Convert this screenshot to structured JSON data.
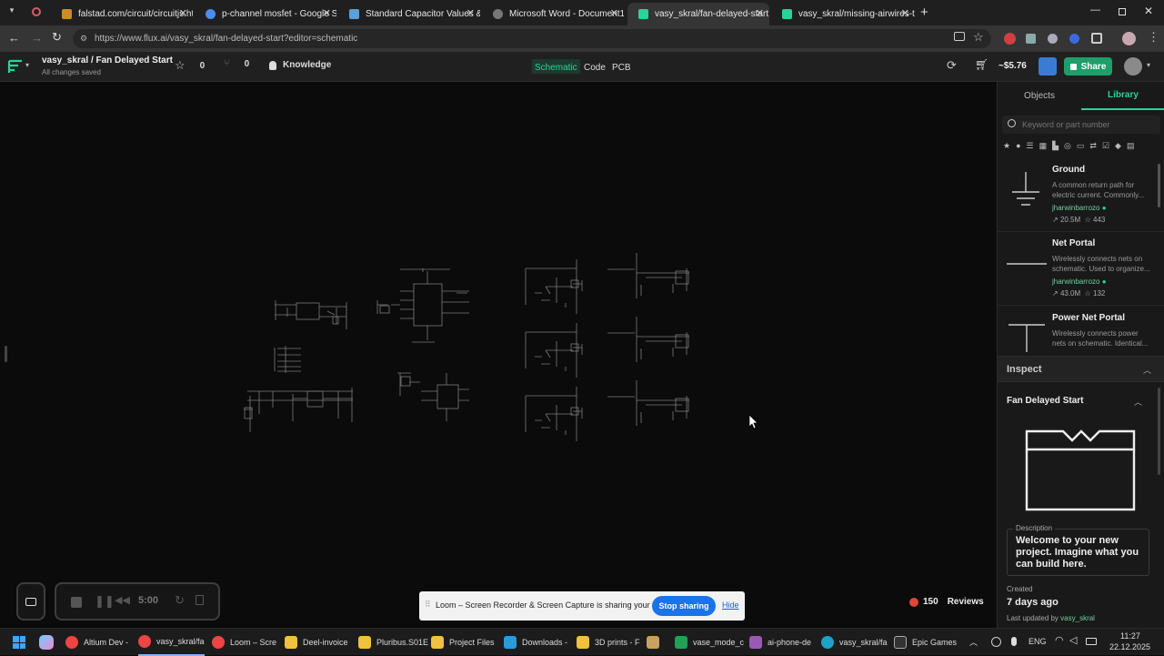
{
  "browser": {
    "tabs": [
      {
        "label": "falstad.com/circuit/circuitjs.htm",
        "color": "#d08a2c"
      },
      {
        "label": "p-channel mosfet - Google Sea",
        "color": "#4a8cf0"
      },
      {
        "label": "Standard Capacitor Values & C",
        "color": "#5aa0d8"
      },
      {
        "label": "Microsoft Word - Document1",
        "color": "#777777"
      },
      {
        "label": "vasy_skral/fan-delayed-start: B",
        "color": "#2bd29b"
      },
      {
        "label": "vasy_skral/missing-airwires-tes",
        "color": "#2bd29b"
      }
    ],
    "url": "https://www.flux.ai/vasy_skral/fan-delayed-start?editor=schematic"
  },
  "header": {
    "breadcrumb": "vasy_skral / Fan Delayed Start",
    "status": "All changes saved",
    "star_count": "0",
    "fork_count": "0",
    "knowledge_label": "Knowledge",
    "tabs": [
      "Schematic",
      "Code",
      "PCB"
    ],
    "price": "~$5.76",
    "share_label": "Share"
  },
  "sidebar": {
    "tabs": [
      "Objects",
      "Library"
    ],
    "search_placeholder": "Keyword or part number",
    "library_items": [
      {
        "title": "Ground",
        "desc": "A common return path for electric current. Commonly...",
        "author": "jharwinbarrozo",
        "downloads": "20.5M",
        "stars": "443"
      },
      {
        "title": "Net Portal",
        "desc": "Wirelessly connects nets on schematic. Used to organize...",
        "author": "jharwinbarrozo",
        "downloads": "43.0M",
        "stars": "132"
      },
      {
        "title": "Power Net Portal",
        "desc": "Wirelessly connects power nets on schematic. Identical...",
        "author": "",
        "downloads": "",
        "stars": ""
      }
    ],
    "inspect_label": "Inspect",
    "project_title": "Fan Delayed Start",
    "description_label": "Description",
    "description_text": "Welcome to your new project. Imagine what you can build here.",
    "created_label": "Created",
    "created_value": "7 days ago",
    "last_updated_label": "Last updated by",
    "last_updated_by": "vasy_skral"
  },
  "loom": {
    "timer": "5:00",
    "banner_text": "Loom – Screen Recorder & Screen Capture is sharing your screen.",
    "stop_label": "Stop sharing",
    "hide_label": "Hide"
  },
  "reviews": {
    "count": "150",
    "label": "Reviews"
  },
  "taskbar": {
    "items": [
      "Altium Dev -",
      "vasy_skral/fa",
      "Loom – Scre",
      "Deel-invoice",
      "Pluribus.S01E",
      "Project Files",
      "Downloads -",
      "3D prints - F",
      "",
      "vase_mode_c",
      "ai-phone-de",
      "vasy_skral/fa",
      "Epic Games"
    ],
    "lang": "ENG",
    "time": "11:27",
    "date": "22.12.2025"
  }
}
